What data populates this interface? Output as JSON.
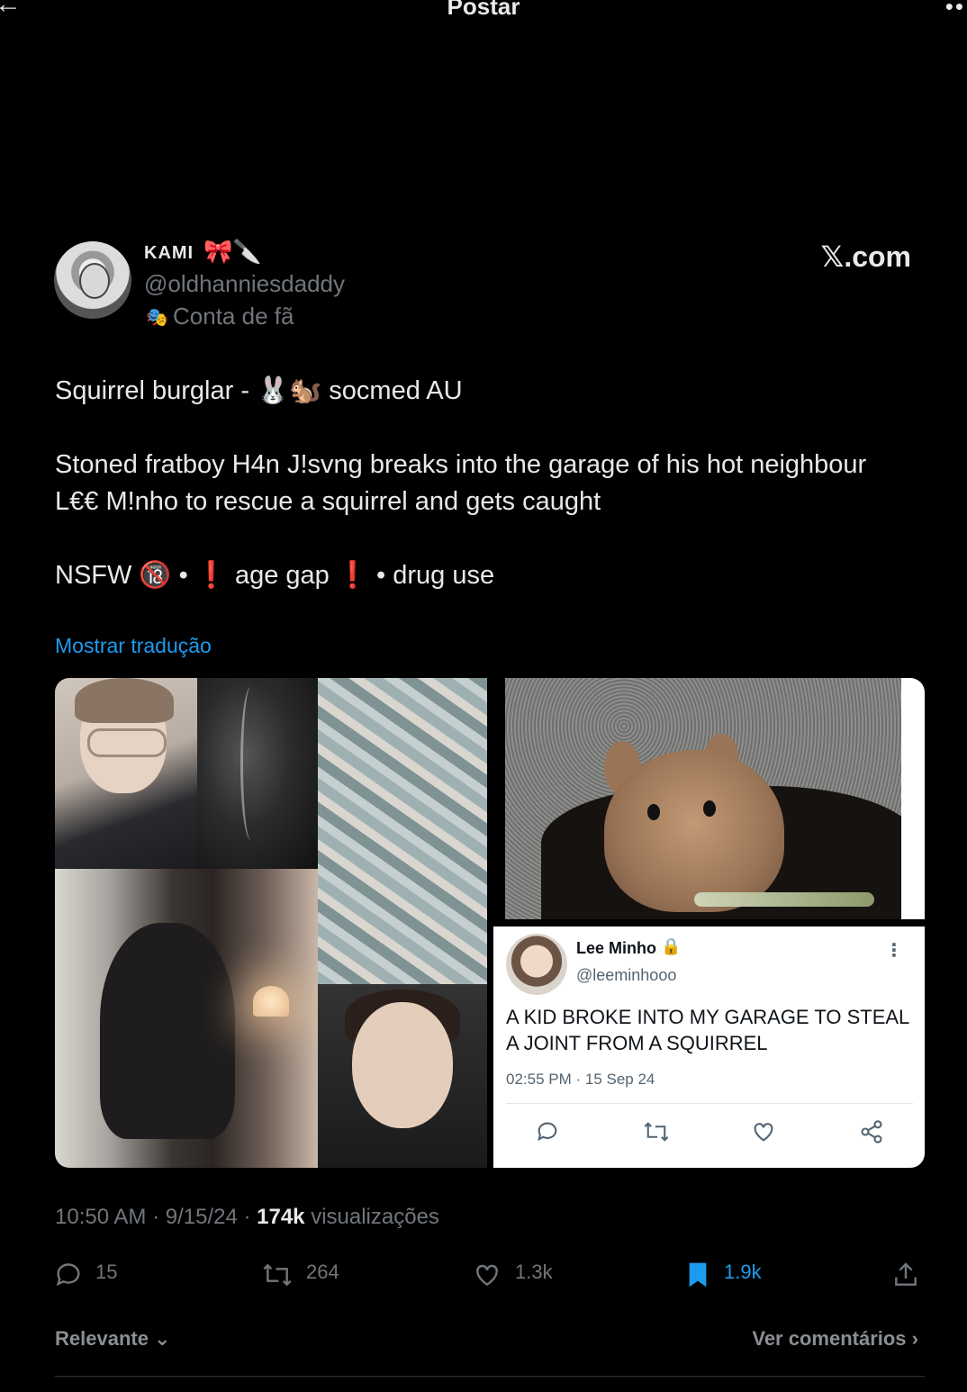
{
  "header": {
    "back_icon": "arrow-left-icon",
    "title": "Postar",
    "more_icon": "more-icon"
  },
  "author": {
    "name": "KAMI",
    "name_emojis": "🎀🔪",
    "handle": "@oldhanniesdaddy",
    "badge_icon": "🎭",
    "badge_label": "Conta de fã"
  },
  "brand": "𝕏.com",
  "tweet": {
    "line1": "Squirrel burglar - 🐰🐿️ socmed AU",
    "line2": "Stoned fratboy H4n J!svng breaks into the garage of his hot neighbour",
    "line3": "L€€ M!nho to rescue a squirrel and gets caught",
    "line4": "NSFW 🔞 • ❗ age gap ❗ • drug use",
    "translate": "Mostrar tradução"
  },
  "embedded": {
    "name": "Lee Minho",
    "lock": "🔒",
    "handle": "@leeminhooo",
    "more": "⋮",
    "text": "A KID BROKE INTO MY GARAGE TO STEAL A JOINT FROM A SQUIRREL",
    "time": "02:55 PM · 15 Sep 24"
  },
  "meta": {
    "time": "10:50 AM · 9/15/24 · ",
    "views": "174k",
    "views_label": " visualizações"
  },
  "actions": {
    "replies": "15",
    "reposts": "264",
    "likes": "1.3k",
    "bookmarks": "1.9k"
  },
  "footer": {
    "sort": "Relevante ⌄",
    "comments": "Ver comentários ›"
  },
  "colors": {
    "accent": "#1d9bf0",
    "background": "#000000",
    "muted": "#71767b"
  }
}
